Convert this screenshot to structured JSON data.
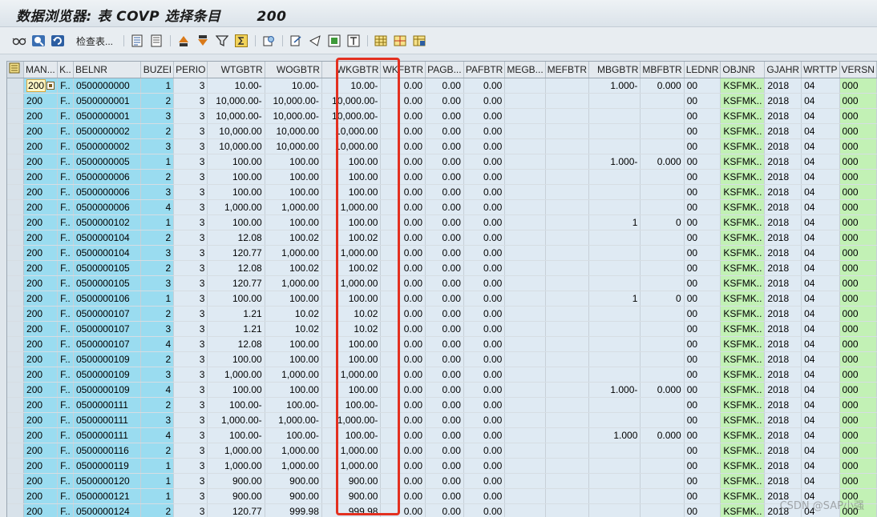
{
  "window": {
    "title": "数据浏览器: 表 COVP 选择条目       200"
  },
  "toolbar": {
    "check_table_label": "检查表..."
  },
  "columns": [
    "MAN...",
    "K..",
    "BELNR",
    "BUZEI",
    "PERIO",
    "WTGBTR",
    "WOGBTR",
    "WKGBTR",
    "WKFBTR",
    "PAGB...",
    "PAFBTR",
    "MEGB...",
    "MEFBTR",
    "MBGBTR",
    "MBFBTR",
    "LEDNR",
    "OBJNR",
    "GJAHR",
    "WRTTP",
    "VERSN"
  ],
  "rows": [
    {
      "man": "200",
      "k": "F..",
      "belnr": "0500000000",
      "buzei": "1",
      "perio": "3",
      "wtgbtr": "10.00-",
      "wogbtr": "10.00-",
      "wkgbtr": "10.00-",
      "wkfbtr": "0.00",
      "pagb": "0.00",
      "pafbtr": "0.00",
      "megb": "",
      "mefbtr": "",
      "mbgbtr": "1.000-",
      "mbfbtr": "0.000",
      "lednr": "00",
      "objnr": "KSFMK..",
      "gjahr": "2018",
      "wrttp": "04",
      "versn": "000"
    },
    {
      "man": "200",
      "k": "F..",
      "belnr": "0500000001",
      "buzei": "2",
      "perio": "3",
      "wtgbtr": "10,000.00-",
      "wogbtr": "10,000.00-",
      "wkgbtr": "10,000.00-",
      "wkfbtr": "0.00",
      "pagb": "0.00",
      "pafbtr": "0.00",
      "megb": "",
      "mefbtr": "",
      "mbgbtr": "",
      "mbfbtr": "",
      "lednr": "00",
      "objnr": "KSFMK..",
      "gjahr": "2018",
      "wrttp": "04",
      "versn": "000"
    },
    {
      "man": "200",
      "k": "F..",
      "belnr": "0500000001",
      "buzei": "3",
      "perio": "3",
      "wtgbtr": "10,000.00-",
      "wogbtr": "10,000.00-",
      "wkgbtr": "10,000.00-",
      "wkfbtr": "0.00",
      "pagb": "0.00",
      "pafbtr": "0.00",
      "megb": "",
      "mefbtr": "",
      "mbgbtr": "",
      "mbfbtr": "",
      "lednr": "00",
      "objnr": "KSFMK..",
      "gjahr": "2018",
      "wrttp": "04",
      "versn": "000"
    },
    {
      "man": "200",
      "k": "F..",
      "belnr": "0500000002",
      "buzei": "2",
      "perio": "3",
      "wtgbtr": "10,000.00",
      "wogbtr": "10,000.00",
      "wkgbtr": "10,000.00",
      "wkfbtr": "0.00",
      "pagb": "0.00",
      "pafbtr": "0.00",
      "megb": "",
      "mefbtr": "",
      "mbgbtr": "",
      "mbfbtr": "",
      "lednr": "00",
      "objnr": "KSFMK..",
      "gjahr": "2018",
      "wrttp": "04",
      "versn": "000"
    },
    {
      "man": "200",
      "k": "F..",
      "belnr": "0500000002",
      "buzei": "3",
      "perio": "3",
      "wtgbtr": "10,000.00",
      "wogbtr": "10,000.00",
      "wkgbtr": "10,000.00",
      "wkfbtr": "0.00",
      "pagb": "0.00",
      "pafbtr": "0.00",
      "megb": "",
      "mefbtr": "",
      "mbgbtr": "",
      "mbfbtr": "",
      "lednr": "00",
      "objnr": "KSFMK..",
      "gjahr": "2018",
      "wrttp": "04",
      "versn": "000"
    },
    {
      "man": "200",
      "k": "F..",
      "belnr": "0500000005",
      "buzei": "1",
      "perio": "3",
      "wtgbtr": "100.00",
      "wogbtr": "100.00",
      "wkgbtr": "100.00",
      "wkfbtr": "0.00",
      "pagb": "0.00",
      "pafbtr": "0.00",
      "megb": "",
      "mefbtr": "",
      "mbgbtr": "1.000-",
      "mbfbtr": "0.000",
      "lednr": "00",
      "objnr": "KSFMK..",
      "gjahr": "2018",
      "wrttp": "04",
      "versn": "000"
    },
    {
      "man": "200",
      "k": "F..",
      "belnr": "0500000006",
      "buzei": "2",
      "perio": "3",
      "wtgbtr": "100.00",
      "wogbtr": "100.00",
      "wkgbtr": "100.00",
      "wkfbtr": "0.00",
      "pagb": "0.00",
      "pafbtr": "0.00",
      "megb": "",
      "mefbtr": "",
      "mbgbtr": "",
      "mbfbtr": "",
      "lednr": "00",
      "objnr": "KSFMK..",
      "gjahr": "2018",
      "wrttp": "04",
      "versn": "000"
    },
    {
      "man": "200",
      "k": "F..",
      "belnr": "0500000006",
      "buzei": "3",
      "perio": "3",
      "wtgbtr": "100.00",
      "wogbtr": "100.00",
      "wkgbtr": "100.00",
      "wkfbtr": "0.00",
      "pagb": "0.00",
      "pafbtr": "0.00",
      "megb": "",
      "mefbtr": "",
      "mbgbtr": "",
      "mbfbtr": "",
      "lednr": "00",
      "objnr": "KSFMK..",
      "gjahr": "2018",
      "wrttp": "04",
      "versn": "000"
    },
    {
      "man": "200",
      "k": "F..",
      "belnr": "0500000006",
      "buzei": "4",
      "perio": "3",
      "wtgbtr": "1,000.00",
      "wogbtr": "1,000.00",
      "wkgbtr": "1,000.00",
      "wkfbtr": "0.00",
      "pagb": "0.00",
      "pafbtr": "0.00",
      "megb": "",
      "mefbtr": "",
      "mbgbtr": "",
      "mbfbtr": "",
      "lednr": "00",
      "objnr": "KSFMK..",
      "gjahr": "2018",
      "wrttp": "04",
      "versn": "000"
    },
    {
      "man": "200",
      "k": "F..",
      "belnr": "0500000102",
      "buzei": "1",
      "perio": "3",
      "wtgbtr": "100.00",
      "wogbtr": "100.00",
      "wkgbtr": "100.00",
      "wkfbtr": "0.00",
      "pagb": "0.00",
      "pafbtr": "0.00",
      "megb": "",
      "mefbtr": "",
      "mbgbtr": "1",
      "mbfbtr": "0",
      "lednr": "00",
      "objnr": "KSFMK..",
      "gjahr": "2018",
      "wrttp": "04",
      "versn": "000"
    },
    {
      "man": "200",
      "k": "F..",
      "belnr": "0500000104",
      "buzei": "2",
      "perio": "3",
      "wtgbtr": "12.08",
      "wogbtr": "100.02",
      "wkgbtr": "100.02",
      "wkfbtr": "0.00",
      "pagb": "0.00",
      "pafbtr": "0.00",
      "megb": "",
      "mefbtr": "",
      "mbgbtr": "",
      "mbfbtr": "",
      "lednr": "00",
      "objnr": "KSFMK..",
      "gjahr": "2018",
      "wrttp": "04",
      "versn": "000"
    },
    {
      "man": "200",
      "k": "F..",
      "belnr": "0500000104",
      "buzei": "3",
      "perio": "3",
      "wtgbtr": "120.77",
      "wogbtr": "1,000.00",
      "wkgbtr": "1,000.00",
      "wkfbtr": "0.00",
      "pagb": "0.00",
      "pafbtr": "0.00",
      "megb": "",
      "mefbtr": "",
      "mbgbtr": "",
      "mbfbtr": "",
      "lednr": "00",
      "objnr": "KSFMK..",
      "gjahr": "2018",
      "wrttp": "04",
      "versn": "000"
    },
    {
      "man": "200",
      "k": "F..",
      "belnr": "0500000105",
      "buzei": "2",
      "perio": "3",
      "wtgbtr": "12.08",
      "wogbtr": "100.02",
      "wkgbtr": "100.02",
      "wkfbtr": "0.00",
      "pagb": "0.00",
      "pafbtr": "0.00",
      "megb": "",
      "mefbtr": "",
      "mbgbtr": "",
      "mbfbtr": "",
      "lednr": "00",
      "objnr": "KSFMK..",
      "gjahr": "2018",
      "wrttp": "04",
      "versn": "000"
    },
    {
      "man": "200",
      "k": "F..",
      "belnr": "0500000105",
      "buzei": "3",
      "perio": "3",
      "wtgbtr": "120.77",
      "wogbtr": "1,000.00",
      "wkgbtr": "1,000.00",
      "wkfbtr": "0.00",
      "pagb": "0.00",
      "pafbtr": "0.00",
      "megb": "",
      "mefbtr": "",
      "mbgbtr": "",
      "mbfbtr": "",
      "lednr": "00",
      "objnr": "KSFMK..",
      "gjahr": "2018",
      "wrttp": "04",
      "versn": "000"
    },
    {
      "man": "200",
      "k": "F..",
      "belnr": "0500000106",
      "buzei": "1",
      "perio": "3",
      "wtgbtr": "100.00",
      "wogbtr": "100.00",
      "wkgbtr": "100.00",
      "wkfbtr": "0.00",
      "pagb": "0.00",
      "pafbtr": "0.00",
      "megb": "",
      "mefbtr": "",
      "mbgbtr": "1",
      "mbfbtr": "0",
      "lednr": "00",
      "objnr": "KSFMK..",
      "gjahr": "2018",
      "wrttp": "04",
      "versn": "000"
    },
    {
      "man": "200",
      "k": "F..",
      "belnr": "0500000107",
      "buzei": "2",
      "perio": "3",
      "wtgbtr": "1.21",
      "wogbtr": "10.02",
      "wkgbtr": "10.02",
      "wkfbtr": "0.00",
      "pagb": "0.00",
      "pafbtr": "0.00",
      "megb": "",
      "mefbtr": "",
      "mbgbtr": "",
      "mbfbtr": "",
      "lednr": "00",
      "objnr": "KSFMK..",
      "gjahr": "2018",
      "wrttp": "04",
      "versn": "000"
    },
    {
      "man": "200",
      "k": "F..",
      "belnr": "0500000107",
      "buzei": "3",
      "perio": "3",
      "wtgbtr": "1.21",
      "wogbtr": "10.02",
      "wkgbtr": "10.02",
      "wkfbtr": "0.00",
      "pagb": "0.00",
      "pafbtr": "0.00",
      "megb": "",
      "mefbtr": "",
      "mbgbtr": "",
      "mbfbtr": "",
      "lednr": "00",
      "objnr": "KSFMK..",
      "gjahr": "2018",
      "wrttp": "04",
      "versn": "000"
    },
    {
      "man": "200",
      "k": "F..",
      "belnr": "0500000107",
      "buzei": "4",
      "perio": "3",
      "wtgbtr": "12.08",
      "wogbtr": "100.00",
      "wkgbtr": "100.00",
      "wkfbtr": "0.00",
      "pagb": "0.00",
      "pafbtr": "0.00",
      "megb": "",
      "mefbtr": "",
      "mbgbtr": "",
      "mbfbtr": "",
      "lednr": "00",
      "objnr": "KSFMK..",
      "gjahr": "2018",
      "wrttp": "04",
      "versn": "000"
    },
    {
      "man": "200",
      "k": "F..",
      "belnr": "0500000109",
      "buzei": "2",
      "perio": "3",
      "wtgbtr": "100.00",
      "wogbtr": "100.00",
      "wkgbtr": "100.00",
      "wkfbtr": "0.00",
      "pagb": "0.00",
      "pafbtr": "0.00",
      "megb": "",
      "mefbtr": "",
      "mbgbtr": "",
      "mbfbtr": "",
      "lednr": "00",
      "objnr": "KSFMK..",
      "gjahr": "2018",
      "wrttp": "04",
      "versn": "000"
    },
    {
      "man": "200",
      "k": "F..",
      "belnr": "0500000109",
      "buzei": "3",
      "perio": "3",
      "wtgbtr": "1,000.00",
      "wogbtr": "1,000.00",
      "wkgbtr": "1,000.00",
      "wkfbtr": "0.00",
      "pagb": "0.00",
      "pafbtr": "0.00",
      "megb": "",
      "mefbtr": "",
      "mbgbtr": "",
      "mbfbtr": "",
      "lednr": "00",
      "objnr": "KSFMK..",
      "gjahr": "2018",
      "wrttp": "04",
      "versn": "000"
    },
    {
      "man": "200",
      "k": "F..",
      "belnr": "0500000109",
      "buzei": "4",
      "perio": "3",
      "wtgbtr": "100.00",
      "wogbtr": "100.00",
      "wkgbtr": "100.00",
      "wkfbtr": "0.00",
      "pagb": "0.00",
      "pafbtr": "0.00",
      "megb": "",
      "mefbtr": "",
      "mbgbtr": "1.000-",
      "mbfbtr": "0.000",
      "lednr": "00",
      "objnr": "KSFMK..",
      "gjahr": "2018",
      "wrttp": "04",
      "versn": "000"
    },
    {
      "man": "200",
      "k": "F..",
      "belnr": "0500000111",
      "buzei": "2",
      "perio": "3",
      "wtgbtr": "100.00-",
      "wogbtr": "100.00-",
      "wkgbtr": "100.00-",
      "wkfbtr": "0.00",
      "pagb": "0.00",
      "pafbtr": "0.00",
      "megb": "",
      "mefbtr": "",
      "mbgbtr": "",
      "mbfbtr": "",
      "lednr": "00",
      "objnr": "KSFMK..",
      "gjahr": "2018",
      "wrttp": "04",
      "versn": "000"
    },
    {
      "man": "200",
      "k": "F..",
      "belnr": "0500000111",
      "buzei": "3",
      "perio": "3",
      "wtgbtr": "1,000.00-",
      "wogbtr": "1,000.00-",
      "wkgbtr": "1,000.00-",
      "wkfbtr": "0.00",
      "pagb": "0.00",
      "pafbtr": "0.00",
      "megb": "",
      "mefbtr": "",
      "mbgbtr": "",
      "mbfbtr": "",
      "lednr": "00",
      "objnr": "KSFMK..",
      "gjahr": "2018",
      "wrttp": "04",
      "versn": "000"
    },
    {
      "man": "200",
      "k": "F..",
      "belnr": "0500000111",
      "buzei": "4",
      "perio": "3",
      "wtgbtr": "100.00-",
      "wogbtr": "100.00-",
      "wkgbtr": "100.00-",
      "wkfbtr": "0.00",
      "pagb": "0.00",
      "pafbtr": "0.00",
      "megb": "",
      "mefbtr": "",
      "mbgbtr": "1.000",
      "mbfbtr": "0.000",
      "lednr": "00",
      "objnr": "KSFMK..",
      "gjahr": "2018",
      "wrttp": "04",
      "versn": "000"
    },
    {
      "man": "200",
      "k": "F..",
      "belnr": "0500000116",
      "buzei": "2",
      "perio": "3",
      "wtgbtr": "1,000.00",
      "wogbtr": "1,000.00",
      "wkgbtr": "1,000.00",
      "wkfbtr": "0.00",
      "pagb": "0.00",
      "pafbtr": "0.00",
      "megb": "",
      "mefbtr": "",
      "mbgbtr": "",
      "mbfbtr": "",
      "lednr": "00",
      "objnr": "KSFMK..",
      "gjahr": "2018",
      "wrttp": "04",
      "versn": "000"
    },
    {
      "man": "200",
      "k": "F..",
      "belnr": "0500000119",
      "buzei": "1",
      "perio": "3",
      "wtgbtr": "1,000.00",
      "wogbtr": "1,000.00",
      "wkgbtr": "1,000.00",
      "wkfbtr": "0.00",
      "pagb": "0.00",
      "pafbtr": "0.00",
      "megb": "",
      "mefbtr": "",
      "mbgbtr": "",
      "mbfbtr": "",
      "lednr": "00",
      "objnr": "KSFMK..",
      "gjahr": "2018",
      "wrttp": "04",
      "versn": "000"
    },
    {
      "man": "200",
      "k": "F..",
      "belnr": "0500000120",
      "buzei": "1",
      "perio": "3",
      "wtgbtr": "900.00",
      "wogbtr": "900.00",
      "wkgbtr": "900.00",
      "wkfbtr": "0.00",
      "pagb": "0.00",
      "pafbtr": "0.00",
      "megb": "",
      "mefbtr": "",
      "mbgbtr": "",
      "mbfbtr": "",
      "lednr": "00",
      "objnr": "KSFMK..",
      "gjahr": "2018",
      "wrttp": "04",
      "versn": "000"
    },
    {
      "man": "200",
      "k": "F..",
      "belnr": "0500000121",
      "buzei": "1",
      "perio": "3",
      "wtgbtr": "900.00",
      "wogbtr": "900.00",
      "wkgbtr": "900.00",
      "wkfbtr": "0.00",
      "pagb": "0.00",
      "pafbtr": "0.00",
      "megb": "",
      "mefbtr": "",
      "mbgbtr": "",
      "mbfbtr": "",
      "lednr": "00",
      "objnr": "KSFMK..",
      "gjahr": "2018",
      "wrttp": "04",
      "versn": "000"
    },
    {
      "man": "200",
      "k": "F..",
      "belnr": "0500000124",
      "buzei": "2",
      "perio": "3",
      "wtgbtr": "120.77",
      "wogbtr": "999.98",
      "wkgbtr": "999.98",
      "wkfbtr": "0.00",
      "pagb": "0.00",
      "pafbtr": "0.00",
      "megb": "",
      "mefbtr": "",
      "mbgbtr": "",
      "mbfbtr": "",
      "lednr": "00",
      "objnr": "KSFMK..",
      "gjahr": "2018",
      "wrttp": "04",
      "versn": "000"
    }
  ],
  "watermark": "CSDN @SAP小强",
  "colors": {
    "key_column": "#9adcf0",
    "version_column": "#c2f1b5",
    "highlight": "#e33020"
  }
}
